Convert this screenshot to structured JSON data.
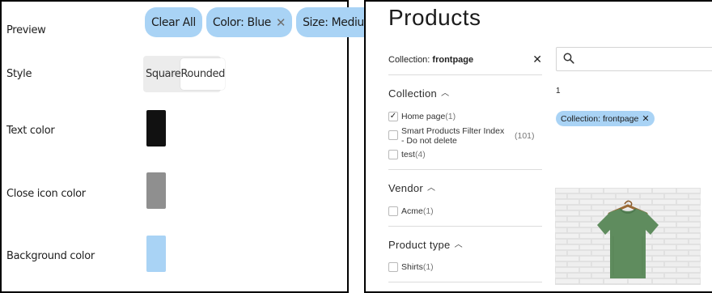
{
  "left": {
    "labels": {
      "preview": "Preview",
      "style": "Style",
      "text_color": "Text color",
      "close_icon_color": "Close icon color",
      "background_color": "Background color"
    },
    "chips": [
      {
        "label": "Clear All"
      },
      {
        "label": "Color: Blue",
        "close": "✕"
      },
      {
        "label": "Size: Medium",
        "close": "✕"
      }
    ],
    "style_options": [
      {
        "label": "Square",
        "selected": false
      },
      {
        "label": "Rounded",
        "selected": true
      }
    ],
    "swatches": {
      "text_color": "#111111",
      "close_icon_color": "#8f8f8f",
      "background_color": "#a9d3f5"
    }
  },
  "right": {
    "title": "Products",
    "applied_filter": {
      "prefix": "Collection: ",
      "value": "frontpage",
      "close": "✕"
    },
    "sections": [
      {
        "title": "Collection",
        "items": [
          {
            "label": "Home page",
            "count": "(1)",
            "checked": true
          },
          {
            "label": "Smart Products Filter Index - Do not delete",
            "count": "(101)",
            "checked": false
          },
          {
            "label": "test",
            "count": "(4)",
            "checked": false
          }
        ]
      },
      {
        "title": "Vendor",
        "items": [
          {
            "label": "Acme",
            "count": "(1)",
            "checked": false
          }
        ]
      },
      {
        "title": "Product type",
        "items": [
          {
            "label": "Shirts",
            "count": "(1)",
            "checked": false
          }
        ]
      }
    ],
    "result_count": "1",
    "filter_tag": {
      "label": "Collection: frontpage",
      "close": "✕"
    },
    "icons": {
      "search": "search-icon",
      "caret": "chevron-up-icon",
      "check": "checkmark-icon"
    }
  }
}
